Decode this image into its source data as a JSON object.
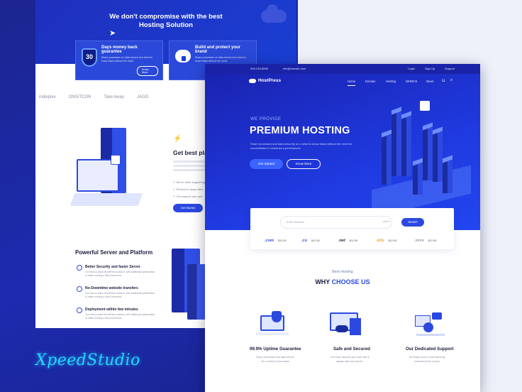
{
  "back_page": {
    "hero_title_line1": "We don't compromise with the best",
    "hero_title_line2": "Hosting Solution",
    "cards": [
      {
        "title": "Days money back guarantee",
        "badge": "30",
        "desc": "Share processes on data secure lora heed to know basis without the need.",
        "button": "Know More"
      },
      {
        "title": "Build and protect your brand",
        "desc": "Share processes on data secure lora heed to know basis without the need."
      }
    ],
    "partner_logos": [
      "indieplex",
      "ONSITCON",
      "Take Away",
      "JAGO"
    ],
    "plan_title": "Get best plan",
    "plan_checks": [
      "We've been supporting",
      "Perfect for large sites",
      "Our easy-to-use web"
    ],
    "plan_button": "Get Started",
    "power_title": "Powerful Server and Platform",
    "power_items": [
      {
        "title": "Better Security and faster Server",
        "desc": "Our best-in-class WordPress solution, with additional optimization to make running a WooCommerce"
      },
      {
        "title": "No-Downtime website transfers",
        "desc": "Our best-in-class WordPress solution, with additional optimization to make running a WooCommerce"
      },
      {
        "title": "Deployment within few minutes",
        "desc": "Our best-in-class WordPress solution, with additional optimization to make running a WooCommerce"
      }
    ]
  },
  "front_page": {
    "topbar": {
      "phone": "009-215-5596",
      "email": "info@domain.com",
      "login": "Login",
      "signup": "Sign Up",
      "support": "Support"
    },
    "logo": "HostPress",
    "menu": [
      "Home",
      "Domain",
      "Hosting",
      "WHMCS",
      "News"
    ],
    "hero": {
      "kicker": "WE PROVIDE",
      "title": "PREMIUM HOSTING",
      "desc": "Share processes and data securely on a need to know basis  without the need for reconciliation it combines a permissions.",
      "btn_primary": "Get Started",
      "btn_secondary": "Know More"
    },
    "search": {
      "placeholder": "Enter Address",
      "select": ".com ▾",
      "button": "Search"
    },
    "tlds": [
      {
        "ext": ".com",
        "price": "$12.95",
        "color": "#2b49e0"
      },
      {
        "ext": ".co",
        "price": "$12.95",
        "color": "#2b49e0"
      },
      {
        "ext": ".net",
        "price": "$12.95",
        "color": "#1a1d3a"
      },
      {
        "ext": ".info",
        "price": "$12.95",
        "color": "#f59f1b"
      },
      {
        "ext": ".store",
        "price": "$12.95",
        "color": "#7a7e92"
      }
    ],
    "section_kicker": "Best Hosting",
    "section_title_a": "WHY",
    "section_title_b": "CHOOSE US",
    "features": [
      {
        "title": "99.9% Uptime Guarantee",
        "desc1": "Share processes and data secure",
        "desc2": "lon a need to know basis"
      },
      {
        "title": "Safe and Secured",
        "desc1": "Our team assured your web site is",
        "desc2": "always safe and secure."
      },
      {
        "title": "Our Dedicated Support",
        "desc1": "we finally found a host that truly",
        "desc2": "understood the unique"
      }
    ]
  },
  "brand": "XpeedStudio"
}
